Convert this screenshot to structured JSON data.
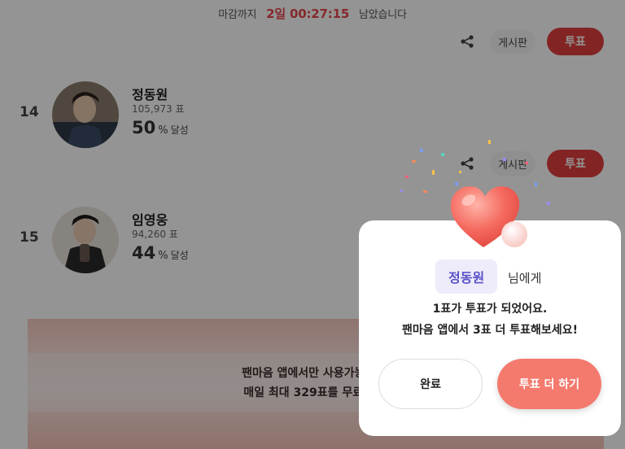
{
  "deadline": {
    "prefix": "마감까지",
    "time": "2일 00:27:15",
    "suffix": "남았습니다"
  },
  "actions": {
    "board_label": "게시판",
    "vote_label": "투표"
  },
  "candidates": [
    {
      "rank": "14",
      "name": "정동원",
      "votes": "105,973 표",
      "rate": "50",
      "rate_symbol": "%",
      "rate_suffix": "달성"
    },
    {
      "rank": "15",
      "name": "임영웅",
      "votes": "94,260 표",
      "rate": "44",
      "rate_symbol": "%",
      "rate_suffix": "달성"
    }
  ],
  "banner": {
    "line1": "팬마음 앱에서만 사용가능한 충",
    "line2": "매일 최대 329표를 무료 충전"
  },
  "modal": {
    "target_name": "정동원",
    "target_suffix": "님에게",
    "message_line1": "1표가 투표가 되었어요.",
    "message_line2": "팬마음 앱에서 3표 더 투표해보세요!",
    "done_label": "완료",
    "more_label": "투표 더 하기"
  },
  "colors": {
    "accent": "#e23f3f",
    "modal_button": "#f47a6e",
    "name_chip_bg": "#eeecfb",
    "name_chip_text": "#5b52c7"
  },
  "icons": [
    "share-icon",
    "heart-icon"
  ]
}
